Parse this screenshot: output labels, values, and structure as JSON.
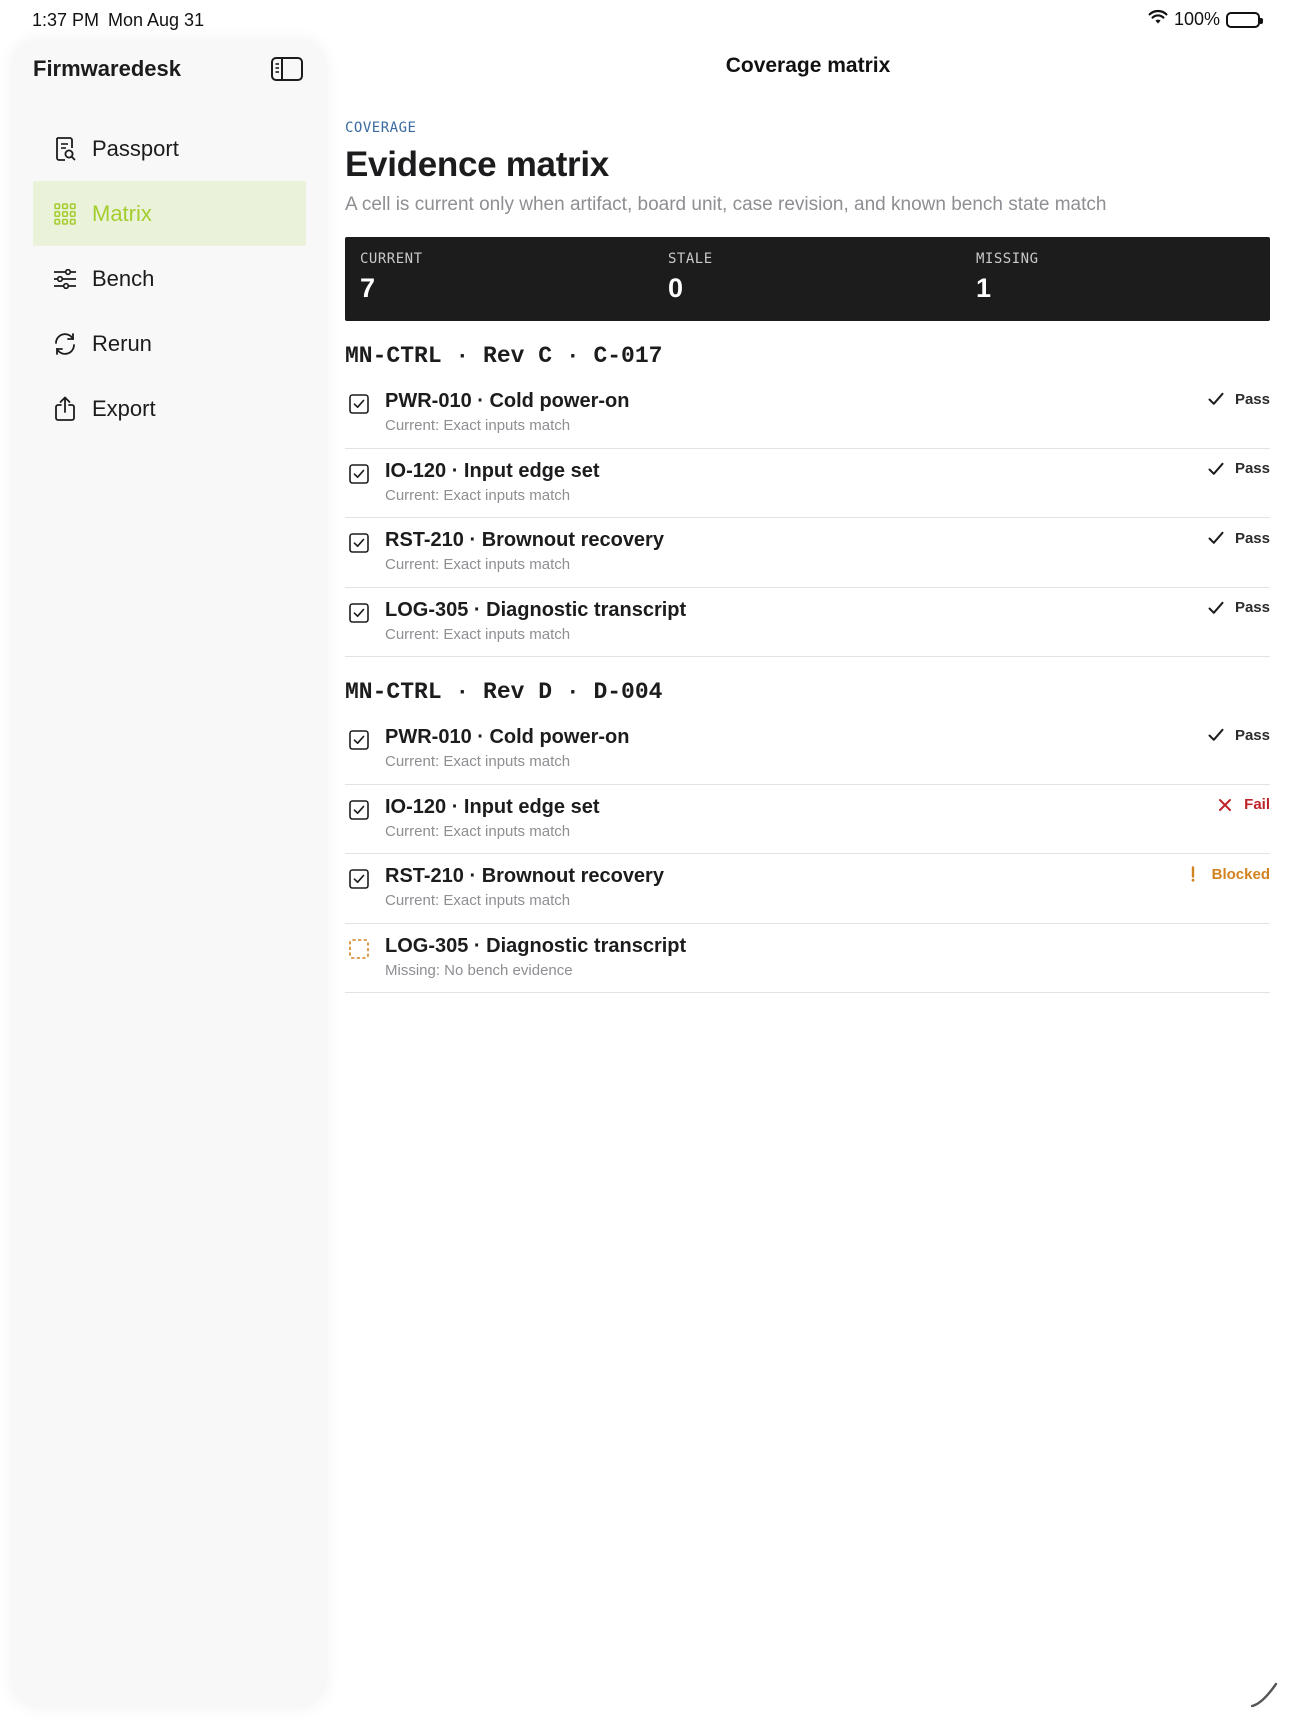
{
  "status_bar": {
    "time": "1:37 PM",
    "date": "Mon Aug 31",
    "battery": "100%"
  },
  "sidebar": {
    "title": "Firmwaredesk",
    "items": [
      {
        "label": "Passport",
        "icon": "passport-icon"
      },
      {
        "label": "Matrix",
        "icon": "grid-icon",
        "active": true
      },
      {
        "label": "Bench",
        "icon": "sliders-icon"
      },
      {
        "label": "Rerun",
        "icon": "rerun-icon"
      },
      {
        "label": "Export",
        "icon": "share-icon"
      }
    ]
  },
  "header": {
    "title": "Coverage matrix"
  },
  "page": {
    "eyebrow": "COVERAGE",
    "heading": "Evidence matrix",
    "subtitle": "A cell is current only when artifact, board unit, case revision, and known bench state match"
  },
  "stats": [
    {
      "label": "CURRENT",
      "value": "7"
    },
    {
      "label": "STALE",
      "value": "0"
    },
    {
      "label": "MISSING",
      "value": "1"
    }
  ],
  "groups": [
    {
      "title": "MN-CTRL · Rev C · C-017",
      "rows": [
        {
          "title": "PWR-010 · Cold power-on",
          "sub": "Current: Exact inputs match",
          "status": "Pass",
          "state": "pass",
          "check": "checked"
        },
        {
          "title": "IO-120 · Input edge set",
          "sub": "Current: Exact inputs match",
          "status": "Pass",
          "state": "pass",
          "check": "checked"
        },
        {
          "title": "RST-210 · Brownout recovery",
          "sub": "Current: Exact inputs match",
          "status": "Pass",
          "state": "pass",
          "check": "checked"
        },
        {
          "title": "LOG-305 · Diagnostic transcript",
          "sub": "Current: Exact inputs match",
          "status": "Pass",
          "state": "pass",
          "check": "checked"
        }
      ]
    },
    {
      "title": "MN-CTRL · Rev D · D-004",
      "rows": [
        {
          "title": "PWR-010 · Cold power-on",
          "sub": "Current: Exact inputs match",
          "status": "Pass",
          "state": "pass",
          "check": "checked"
        },
        {
          "title": "IO-120 · Input edge set",
          "sub": "Current: Exact inputs match",
          "status": "Fail",
          "state": "fail",
          "check": "checked"
        },
        {
          "title": "RST-210 · Brownout recovery",
          "sub": "Current: Exact inputs match",
          "status": "Blocked",
          "state": "blocked",
          "check": "checked"
        },
        {
          "title": "LOG-305 · Diagnostic transcript",
          "sub": "Missing: No bench evidence",
          "status": "",
          "state": "missing",
          "check": "missing"
        }
      ]
    }
  ],
  "colors": {
    "accent": "#a4cd2f",
    "active_bg": "#eaf3d9",
    "eyebrow": "#3a6aa0",
    "stats_bg": "#1b1c1b",
    "fail": "#c0242b",
    "blocked": "#d2821e",
    "missing_box": "#d2821e"
  }
}
